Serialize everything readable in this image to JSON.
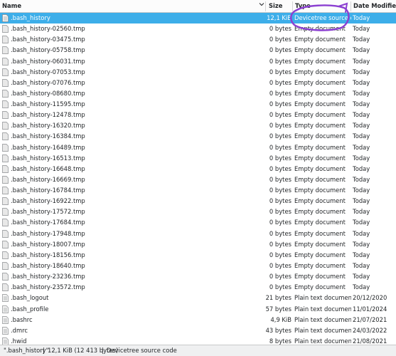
{
  "columns": {
    "name": "Name",
    "size": "Size",
    "type": "Type",
    "date": "Date Modified"
  },
  "rows": [
    {
      "name": ".bash_history",
      "size": "12,1 KiB",
      "type": "Devicetree source code",
      "date": "Today",
      "selected": true,
      "icon": "text-file-icon"
    },
    {
      "name": ".bash_history-02560.tmp",
      "size": "0 bytes",
      "type": "Empty document",
      "date": "Today",
      "icon": "empty-file-icon"
    },
    {
      "name": ".bash_history-03475.tmp",
      "size": "0 bytes",
      "type": "Empty document",
      "date": "Today",
      "icon": "empty-file-icon"
    },
    {
      "name": ".bash_history-05758.tmp",
      "size": "0 bytes",
      "type": "Empty document",
      "date": "Today",
      "icon": "empty-file-icon"
    },
    {
      "name": ".bash_history-06031.tmp",
      "size": "0 bytes",
      "type": "Empty document",
      "date": "Today",
      "icon": "empty-file-icon"
    },
    {
      "name": ".bash_history-07053.tmp",
      "size": "0 bytes",
      "type": "Empty document",
      "date": "Today",
      "icon": "empty-file-icon"
    },
    {
      "name": ".bash_history-07076.tmp",
      "size": "0 bytes",
      "type": "Empty document",
      "date": "Today",
      "icon": "empty-file-icon"
    },
    {
      "name": ".bash_history-08680.tmp",
      "size": "0 bytes",
      "type": "Empty document",
      "date": "Today",
      "icon": "empty-file-icon"
    },
    {
      "name": ".bash_history-11595.tmp",
      "size": "0 bytes",
      "type": "Empty document",
      "date": "Today",
      "icon": "empty-file-icon"
    },
    {
      "name": ".bash_history-12478.tmp",
      "size": "0 bytes",
      "type": "Empty document",
      "date": "Today",
      "icon": "empty-file-icon"
    },
    {
      "name": ".bash_history-16320.tmp",
      "size": "0 bytes",
      "type": "Empty document",
      "date": "Today",
      "icon": "empty-file-icon"
    },
    {
      "name": ".bash_history-16384.tmp",
      "size": "0 bytes",
      "type": "Empty document",
      "date": "Today",
      "icon": "empty-file-icon"
    },
    {
      "name": ".bash_history-16489.tmp",
      "size": "0 bytes",
      "type": "Empty document",
      "date": "Today",
      "icon": "empty-file-icon"
    },
    {
      "name": ".bash_history-16513.tmp",
      "size": "0 bytes",
      "type": "Empty document",
      "date": "Today",
      "icon": "empty-file-icon"
    },
    {
      "name": ".bash_history-16648.tmp",
      "size": "0 bytes",
      "type": "Empty document",
      "date": "Today",
      "icon": "empty-file-icon"
    },
    {
      "name": ".bash_history-16669.tmp",
      "size": "0 bytes",
      "type": "Empty document",
      "date": "Today",
      "icon": "empty-file-icon"
    },
    {
      "name": ".bash_history-16784.tmp",
      "size": "0 bytes",
      "type": "Empty document",
      "date": "Today",
      "icon": "empty-file-icon"
    },
    {
      "name": ".bash_history-16922.tmp",
      "size": "0 bytes",
      "type": "Empty document",
      "date": "Today",
      "icon": "empty-file-icon"
    },
    {
      "name": ".bash_history-17572.tmp",
      "size": "0 bytes",
      "type": "Empty document",
      "date": "Today",
      "icon": "empty-file-icon"
    },
    {
      "name": ".bash_history-17684.tmp",
      "size": "0 bytes",
      "type": "Empty document",
      "date": "Today",
      "icon": "empty-file-icon"
    },
    {
      "name": ".bash_history-17948.tmp",
      "size": "0 bytes",
      "type": "Empty document",
      "date": "Today",
      "icon": "empty-file-icon"
    },
    {
      "name": ".bash_history-18007.tmp",
      "size": "0 bytes",
      "type": "Empty document",
      "date": "Today",
      "icon": "empty-file-icon"
    },
    {
      "name": ".bash_history-18156.tmp",
      "size": "0 bytes",
      "type": "Empty document",
      "date": "Today",
      "icon": "empty-file-icon"
    },
    {
      "name": ".bash_history-18640.tmp",
      "size": "0 bytes",
      "type": "Empty document",
      "date": "Today",
      "icon": "empty-file-icon"
    },
    {
      "name": ".bash_history-23236.tmp",
      "size": "0 bytes",
      "type": "Empty document",
      "date": "Today",
      "icon": "empty-file-icon"
    },
    {
      "name": ".bash_history-23572.tmp",
      "size": "0 bytes",
      "type": "Empty document",
      "date": "Today",
      "icon": "empty-file-icon"
    },
    {
      "name": ".bash_logout",
      "size": "21 bytes",
      "type": "Plain text document",
      "date": "20/12/2020",
      "icon": "text-file-icon"
    },
    {
      "name": ".bash_profile",
      "size": "57 bytes",
      "type": "Plain text document",
      "date": "11/01/2024",
      "icon": "text-file-icon"
    },
    {
      "name": ".bashrc",
      "size": "4,9 KiB",
      "type": "Plain text document",
      "date": "21/07/2021",
      "icon": "text-file-icon"
    },
    {
      "name": ".dmrc",
      "size": "43 bytes",
      "type": "Plain text document",
      "date": "24/03/2022",
      "icon": "text-file-icon"
    },
    {
      "name": ".hwid",
      "size": "8 bytes",
      "type": "Plain text document",
      "date": "21/08/2021",
      "icon": "text-file-icon"
    }
  ],
  "status": {
    "filename": "\".bash_history\"",
    "size": "12,1 KiB (12 413 bytes)",
    "type": "Devicetree source code"
  },
  "colors": {
    "selection": "#3daee9",
    "annotation": "#8b3fd1"
  },
  "annotation": "purple-circle-around-type"
}
